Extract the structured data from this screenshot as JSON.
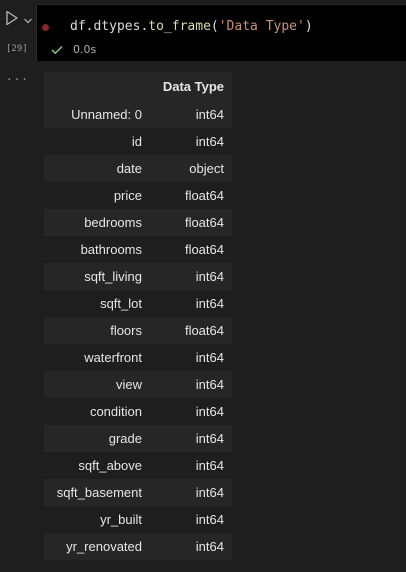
{
  "cell": {
    "execution_count": "[29]",
    "code": {
      "ident": "df",
      "dot1": ".",
      "attr": "dtypes",
      "dot2": ".",
      "method": "to_frame",
      "open": "(",
      "arg": "'Data Type'",
      "close": ")"
    },
    "status": {
      "icon": "check-icon",
      "time": "0.0s",
      "color": "#89d185"
    },
    "output_menu": "..."
  },
  "table": {
    "column_header": "Data Type",
    "rows": [
      {
        "index": "Unnamed: 0",
        "value": "int64"
      },
      {
        "index": "id",
        "value": "int64"
      },
      {
        "index": "date",
        "value": "object"
      },
      {
        "index": "price",
        "value": "float64"
      },
      {
        "index": "bedrooms",
        "value": "float64"
      },
      {
        "index": "bathrooms",
        "value": "float64"
      },
      {
        "index": "sqft_living",
        "value": "int64"
      },
      {
        "index": "sqft_lot",
        "value": "int64"
      },
      {
        "index": "floors",
        "value": "float64"
      },
      {
        "index": "waterfront",
        "value": "int64"
      },
      {
        "index": "view",
        "value": "int64"
      },
      {
        "index": "condition",
        "value": "int64"
      },
      {
        "index": "grade",
        "value": "int64"
      },
      {
        "index": "sqft_above",
        "value": "int64"
      },
      {
        "index": "sqft_basement",
        "value": "int64"
      },
      {
        "index": "yr_built",
        "value": "int64"
      },
      {
        "index": "yr_renovated",
        "value": "int64"
      }
    ]
  },
  "colors": {
    "background": "#1e1e1e",
    "editor": "#000000",
    "stripe": "#262626",
    "breakpoint": "#8a2626"
  }
}
